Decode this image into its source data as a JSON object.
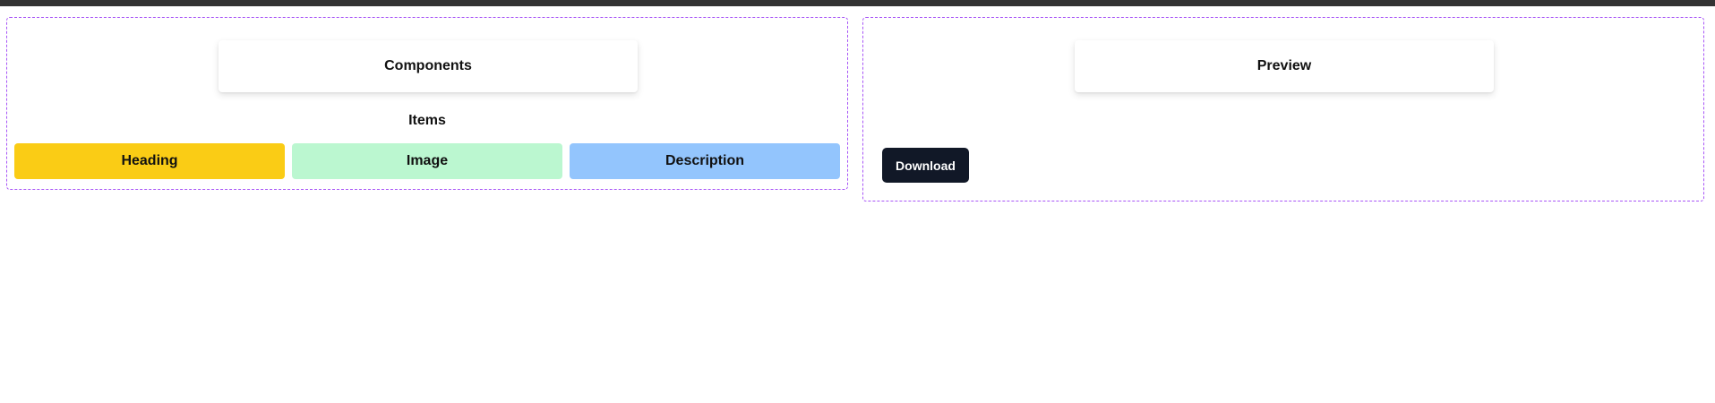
{
  "components_panel": {
    "title": "Components",
    "items_label": "Items",
    "items": [
      {
        "label": "Heading",
        "color": "#facc15"
      },
      {
        "label": "Image",
        "color": "#bbf7d0"
      },
      {
        "label": "Description",
        "color": "#93c5fd"
      }
    ]
  },
  "preview_panel": {
    "title": "Preview",
    "download_label": "Download"
  },
  "colors": {
    "panel_border": "#a855f7",
    "top_bar": "#333333",
    "download_button": "#111827"
  }
}
